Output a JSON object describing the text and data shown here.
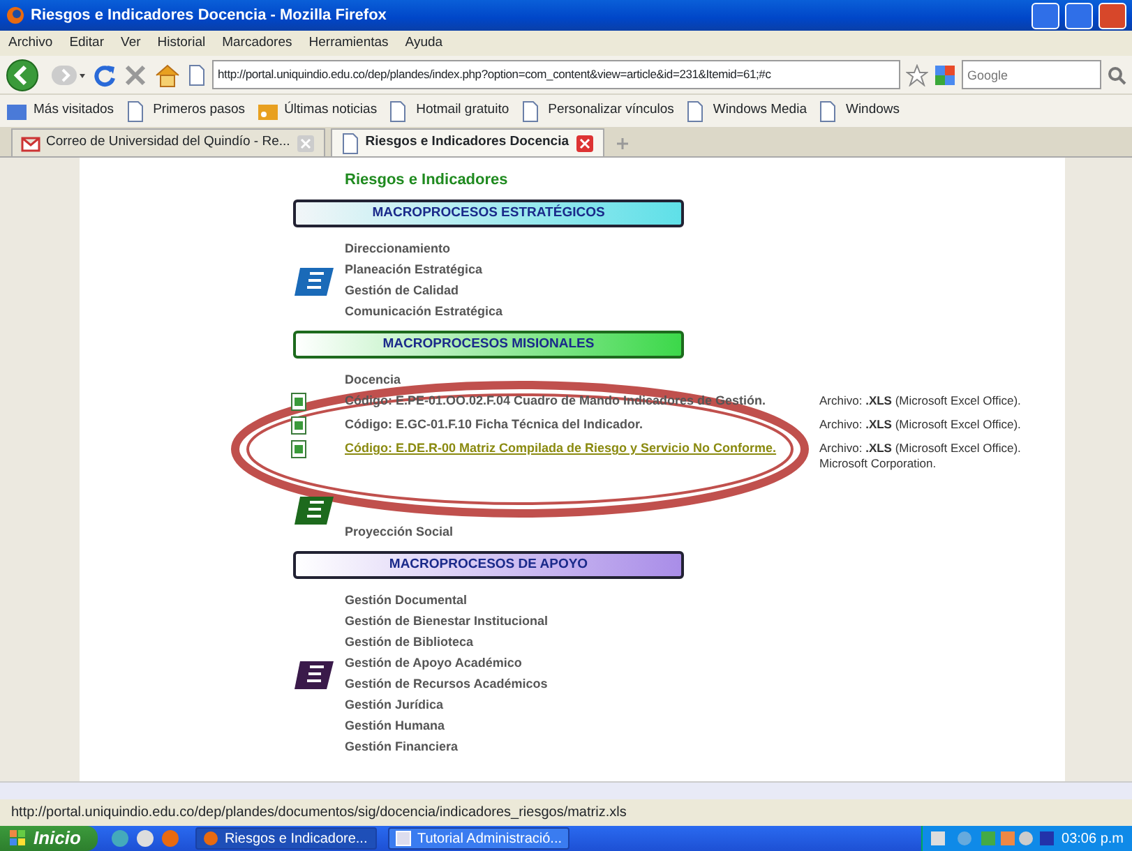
{
  "window": {
    "title": "Riesgos e Indicadores Docencia - Mozilla Firefox"
  },
  "menu": [
    "Archivo",
    "Editar",
    "Ver",
    "Historial",
    "Marcadores",
    "Herramientas",
    "Ayuda"
  ],
  "address_bar": {
    "value": "http://portal.uniquindio.edu.co/dep/plandes/index.php?option=com_content&view=article&id=231&Itemid=61;#c"
  },
  "search": {
    "placeholder": "Google"
  },
  "bookmarks": [
    {
      "label": "Más visitados",
      "kind": "smart"
    },
    {
      "label": "Primeros pasos",
      "kind": "page"
    },
    {
      "label": "Últimas noticias",
      "kind": "feed"
    },
    {
      "label": "Hotmail gratuito",
      "kind": "page"
    },
    {
      "label": "Personalizar vínculos",
      "kind": "page"
    },
    {
      "label": "Windows Media",
      "kind": "page"
    },
    {
      "label": "Windows",
      "kind": "page"
    }
  ],
  "tabs": [
    {
      "label": "Correo de Universidad del Quindío - Re...",
      "selected": false
    },
    {
      "label": "Riesgos e Indicadores Docencia",
      "selected": true
    }
  ],
  "page": {
    "heading": "Riesgos e Indicadores",
    "sections": [
      {
        "title": "MACROPROCESOS ESTRATÉGICOS",
        "kind": "estrategicos",
        "items": [
          {
            "kind": "text",
            "text": "Direccionamiento"
          },
          {
            "kind": "text",
            "text": "Planeación Estratégica"
          },
          {
            "kind": "text",
            "text": "Gestión de Calidad"
          },
          {
            "kind": "text",
            "text": "Comunicación Estratégica"
          }
        ]
      },
      {
        "title": "MACROPROCESOS MISIONALES",
        "kind": "misionales",
        "items": [
          {
            "kind": "text",
            "text": "Docencia"
          },
          {
            "kind": "document",
            "text": "Código: E.PE-01.OO.02.F.04 Cuadro de Mando Indicadores de Gestión.",
            "file": "Archivo: **.XLS** (Microsoft Excel Office).",
            "hover": false
          },
          {
            "kind": "document",
            "text": "Código: E.GC-01.F.10 Ficha Técnica del Indicador.",
            "file": "Archivo: **.XLS** (Microsoft Excel Office).",
            "hover": false
          },
          {
            "kind": "document",
            "text": "Código: E.DE.R-00 Matriz Compilada de Riesgo y Servicio No Conforme.",
            "file": "Archivo: **.XLS** (Microsoft Excel Office). Microsoft Corporation.",
            "hover": true
          },
          {
            "kind": "spacer"
          },
          {
            "kind": "text",
            "text": "Proyección Social"
          }
        ]
      },
      {
        "title": "MACROPROCESOS DE APOYO",
        "kind": "apoyo",
        "items": [
          {
            "kind": "text",
            "text": "Gestión Documental"
          },
          {
            "kind": "text",
            "text": "Gestión de Bienestar Institucional"
          },
          {
            "kind": "text",
            "text": "Gestión de Biblioteca"
          },
          {
            "kind": "text",
            "text": "Gestión de Apoyo Académico"
          },
          {
            "kind": "text",
            "text": "Gestión de Recursos Académicos"
          },
          {
            "kind": "text",
            "text": "Gestión Jurídica"
          },
          {
            "kind": "text",
            "text": "Gestión Humana"
          },
          {
            "kind": "text",
            "text": "Gestión Financiera"
          }
        ]
      }
    ]
  },
  "status_bar": "http://portal.uniquindio.edu.co/dep/plandes/documentos/sig/docencia/indicadores_riesgos/matriz.xls",
  "taskbar": {
    "start": "Inicio",
    "tasks": [
      {
        "label": "Riesgos e Indicadore...",
        "selected": true
      },
      {
        "label": "Tutorial Administració...",
        "selected": false
      }
    ],
    "clock": "03:06 p.m"
  }
}
